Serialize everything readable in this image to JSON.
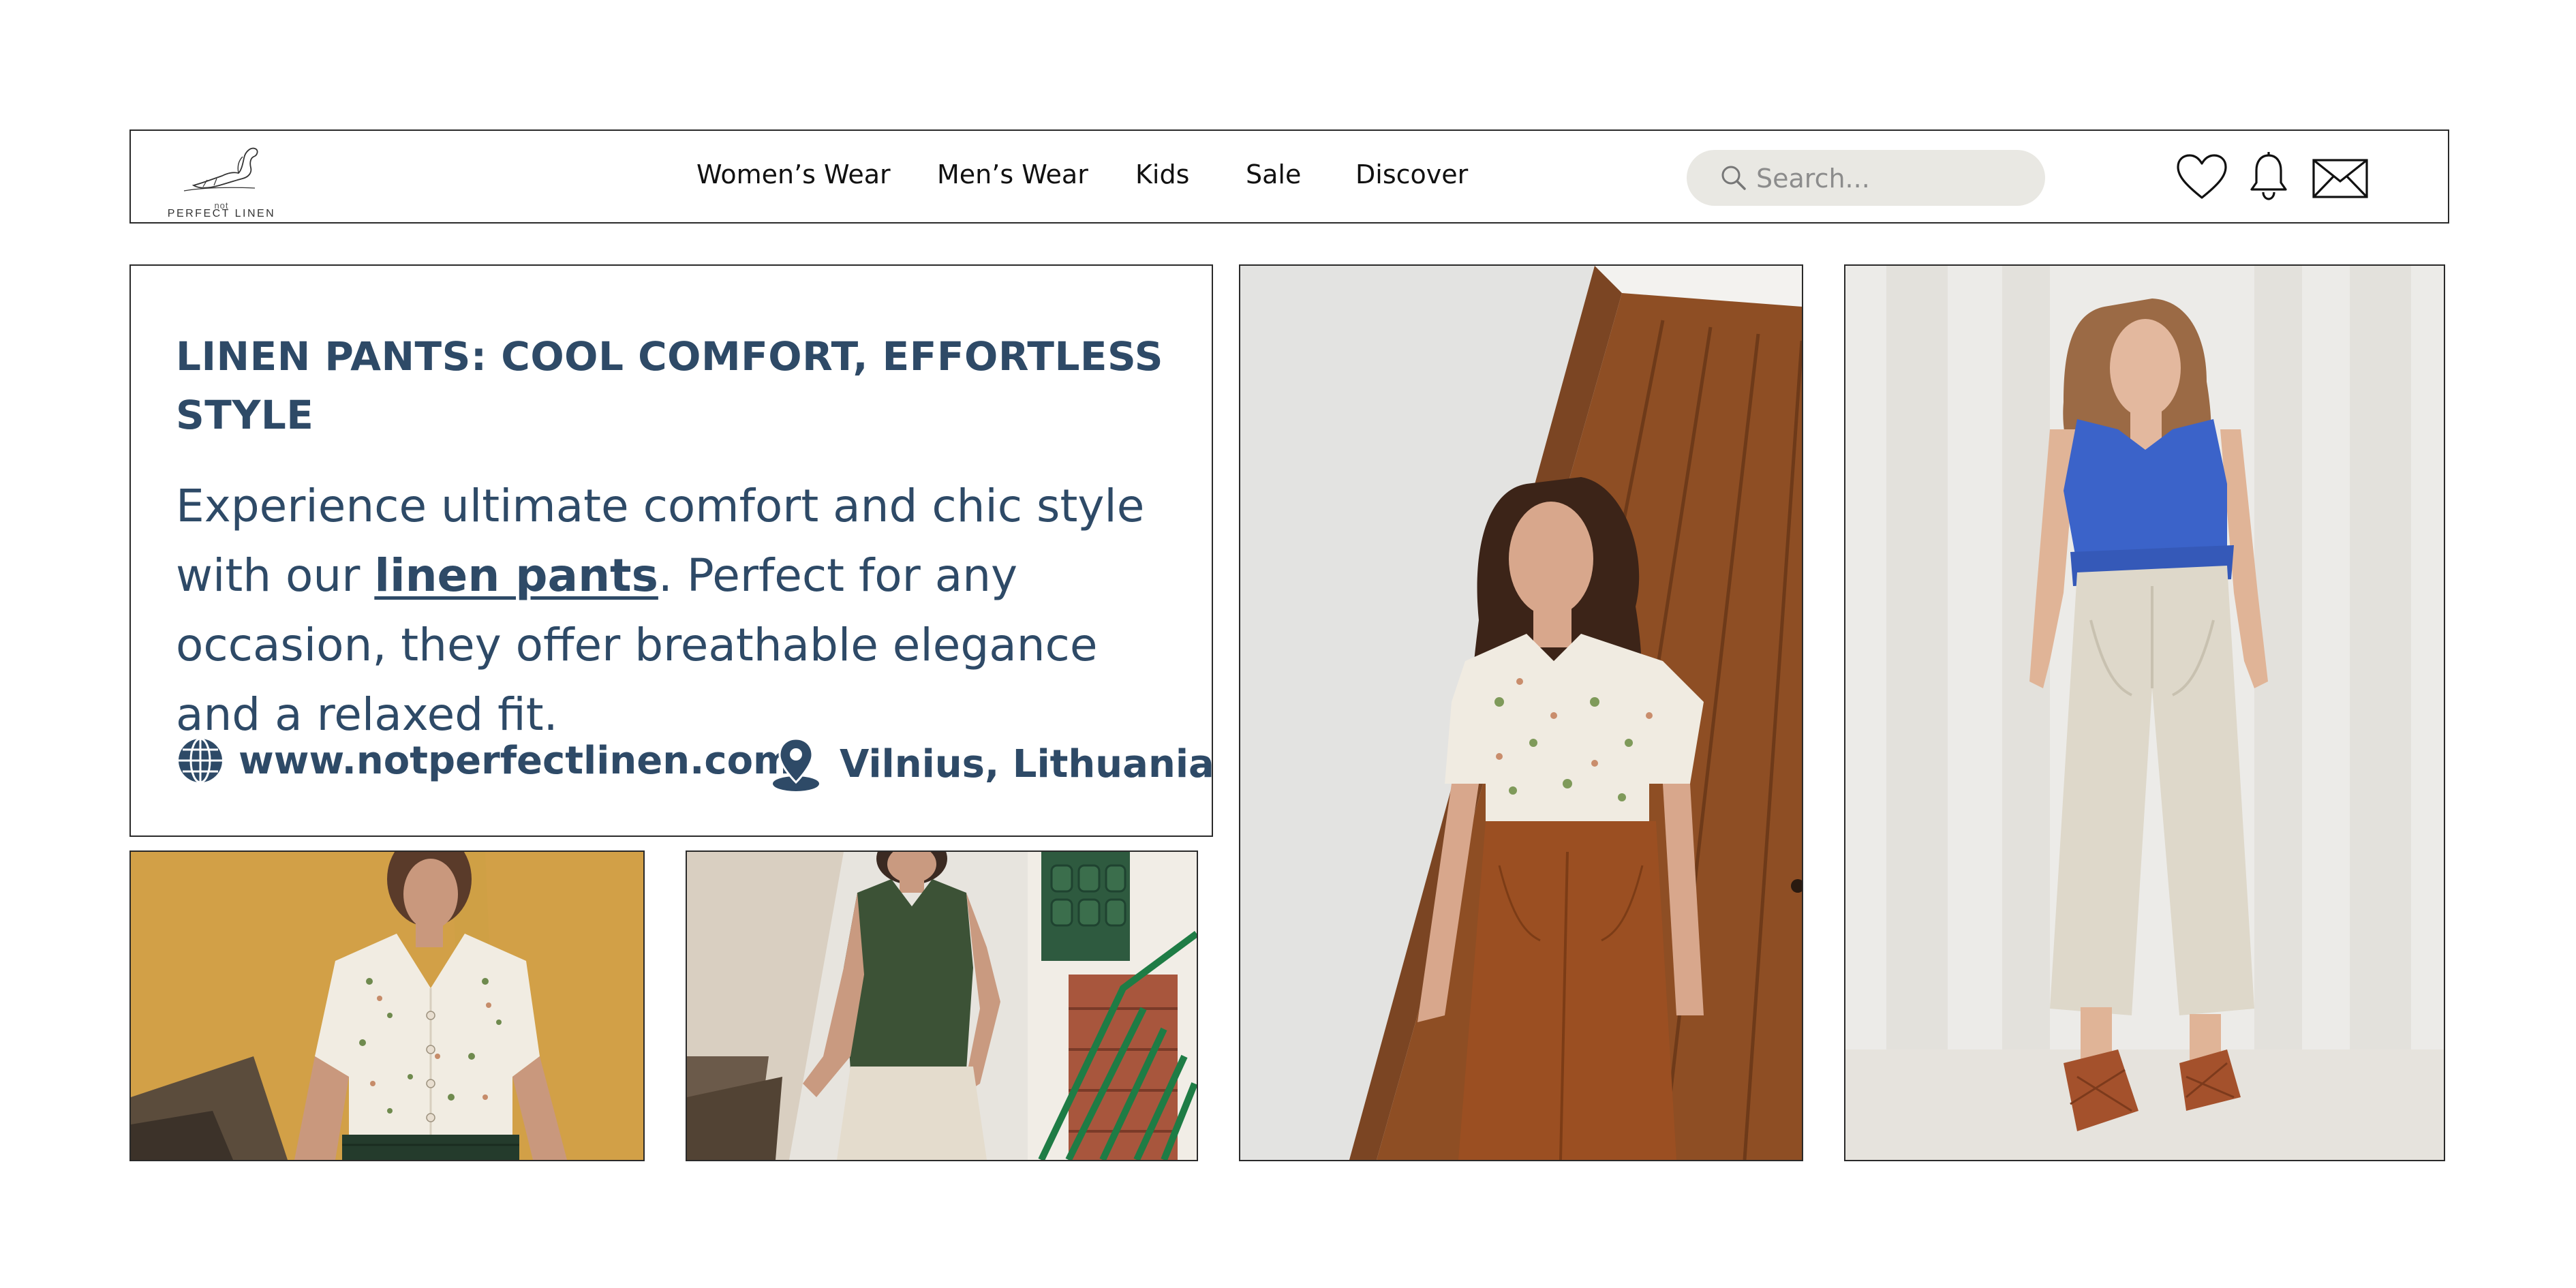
{
  "brand": {
    "logo_sub": "not",
    "logo_main": "PERFECT LINEN"
  },
  "nav": {
    "links": [
      "Women’s Wear",
      "Men’s Wear",
      "Kids",
      "Sale",
      "Discover"
    ],
    "search_placeholder": "Search...",
    "icons": [
      "heart-icon",
      "bell-icon",
      "mail-icon"
    ]
  },
  "info": {
    "headline": "LINEN PANTS: COOL COMFORT, EFFORTLESS STYLE",
    "body_before": "Experience ultimate comfort and chic style with our ",
    "body_link": "linen pants",
    "body_after": ". Perfect for any occasion, they offer breathable elegance and a relaxed fit.",
    "website": "www.notperfectlinen.com",
    "location": "Vilnius, Lithuania"
  },
  "photos": [
    {
      "name": "floral-blouse-photo",
      "subject": "woman in floral blouse and dark green pants against yellow wall"
    },
    {
      "name": "green-top-photo",
      "subject": "woman in dark green linen top and cream pants by green gate"
    },
    {
      "name": "door-photo",
      "subject": "woman in floral blouse and rust linen pants leaning on wooden door"
    },
    {
      "name": "blue-top-photo",
      "subject": "woman in blue linen tank top and natural linen wide pants"
    }
  ],
  "colors": {
    "text_primary": "#2e4a67",
    "search_bg": "#e9e8e3",
    "border": "#2a2a2a",
    "yellow_wall": "#d9a94e",
    "green_top": "#3e5238",
    "rust_pants": "#9b4f22",
    "blue_top": "#3b63c9",
    "linen": "#dcd6c8"
  }
}
